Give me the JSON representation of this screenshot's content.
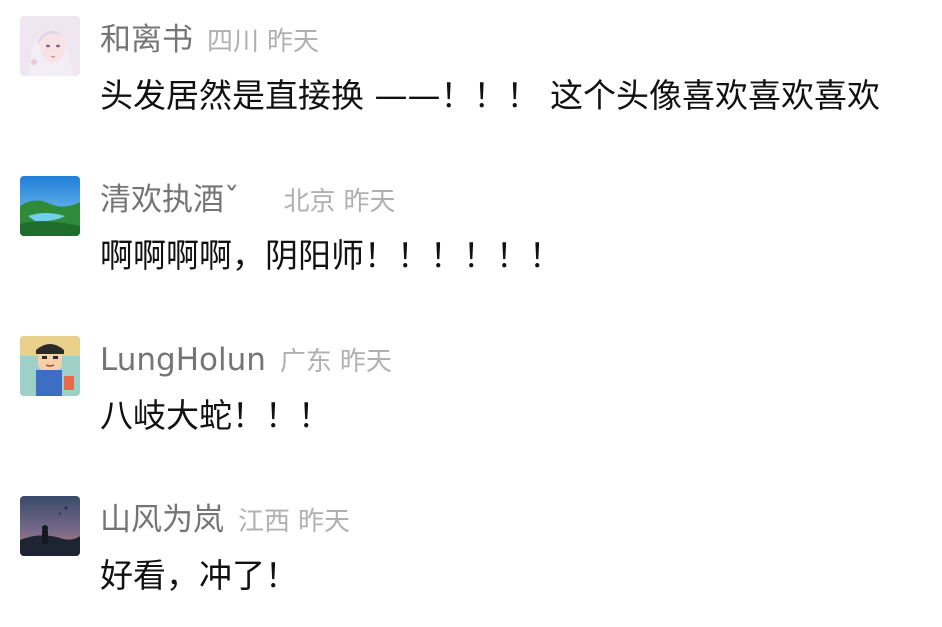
{
  "comments": [
    {
      "avatar_icon": "avatar-anime-girl-icon",
      "username": "和离书",
      "location": "四川",
      "time": "昨天",
      "text": "头发居然是直接换 ——！！！ 这个头像喜欢喜欢喜欢"
    },
    {
      "avatar_icon": "avatar-lake-landscape-icon",
      "username": "清欢执酒ˇ",
      "location": "北京",
      "time": "昨天",
      "text": "啊啊啊啊，阴阳师！！！！！！"
    },
    {
      "avatar_icon": "avatar-cartoon-boy-icon",
      "username": "LungHolun",
      "location": "广东",
      "time": "昨天",
      "text": "八岐大蛇！！！"
    },
    {
      "avatar_icon": "avatar-dusk-scene-icon",
      "username": "山风为岚",
      "location": "江西",
      "time": "昨天",
      "text": "好看，冲了！"
    }
  ]
}
